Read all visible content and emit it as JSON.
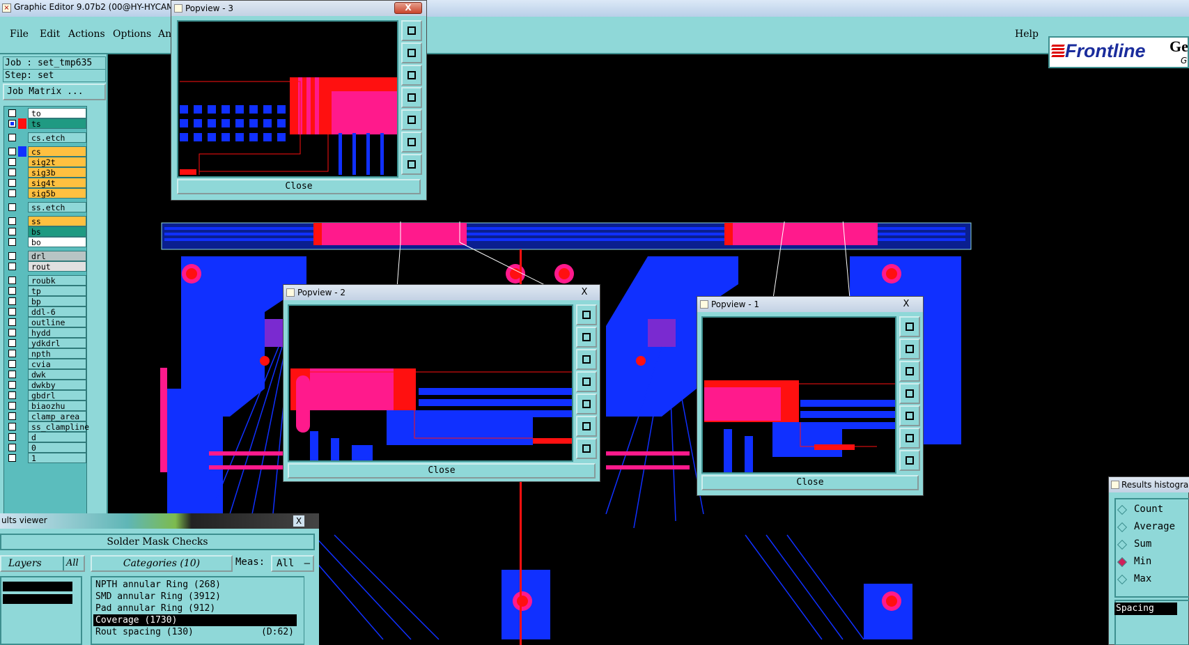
{
  "app": {
    "title": "Graphic Editor 9.07b2 (00@HY-HYCAM-PC"
  },
  "menu": {
    "file": "File",
    "edit": "Edit",
    "actions": "Actions",
    "options": "Options",
    "analysis": "Analysi",
    "help": "Help"
  },
  "logo": {
    "brand": "Frontline",
    "suffix": "Ge",
    "suffix2": "G"
  },
  "job": {
    "job_label": "Job : set_tmp635",
    "step_label": "Step: set",
    "matrix_button": "Job Matrix ..."
  },
  "layers": [
    {
      "name": "to",
      "color": "#ffffff",
      "swatch": "",
      "checked": false
    },
    {
      "name": "ts",
      "color": "#1f9a82",
      "swatch": "#ff1010",
      "checked": true
    },
    {
      "name": "cs.etch",
      "color": "#8fd8d8",
      "swatch": "",
      "checked": false
    },
    {
      "name": "cs",
      "color": "#ffc040",
      "swatch": "#1030ff",
      "checked": false
    },
    {
      "name": "sig2t",
      "color": "#ffc040",
      "swatch": "",
      "checked": false
    },
    {
      "name": "sig3b",
      "color": "#ffc040",
      "swatch": "",
      "checked": false
    },
    {
      "name": "sig4t",
      "color": "#ffc040",
      "swatch": "",
      "checked": false
    },
    {
      "name": "sig5b",
      "color": "#ffc040",
      "swatch": "",
      "checked": false
    },
    {
      "name": "ss.etch",
      "color": "#8fd8d8",
      "swatch": "",
      "checked": false
    },
    {
      "name": "ss",
      "color": "#ffc040",
      "swatch": "",
      "checked": false
    },
    {
      "name": "bs",
      "color": "#1f9a82",
      "swatch": "",
      "checked": false
    },
    {
      "name": "bo",
      "color": "#ffffff",
      "swatch": "",
      "checked": false
    },
    {
      "name": "drl",
      "color": "#b8c4c4",
      "swatch": "",
      "checked": false
    },
    {
      "name": "rout",
      "color": "#e0e0e0",
      "swatch": "",
      "checked": false
    },
    {
      "name": "roubk",
      "color": "#8fd8d8",
      "swatch": "",
      "checked": false
    },
    {
      "name": "tp",
      "color": "#8fd8d8",
      "swatch": "",
      "checked": false
    },
    {
      "name": "bp",
      "color": "#8fd8d8",
      "swatch": "",
      "checked": false
    },
    {
      "name": "ddl-6",
      "color": "#8fd8d8",
      "swatch": "",
      "checked": false
    },
    {
      "name": "outline",
      "color": "#8fd8d8",
      "swatch": "",
      "checked": false
    },
    {
      "name": "hydd",
      "color": "#8fd8d8",
      "swatch": "",
      "checked": false
    },
    {
      "name": "ydkdrl",
      "color": "#8fd8d8",
      "swatch": "",
      "checked": false
    },
    {
      "name": "npth",
      "color": "#8fd8d8",
      "swatch": "",
      "checked": false
    },
    {
      "name": "cvia",
      "color": "#8fd8d8",
      "swatch": "",
      "checked": false
    },
    {
      "name": "dwk",
      "color": "#8fd8d8",
      "swatch": "",
      "checked": false
    },
    {
      "name": "dwkby",
      "color": "#8fd8d8",
      "swatch": "",
      "checked": false
    },
    {
      "name": "gbdrl",
      "color": "#8fd8d8",
      "swatch": "",
      "checked": false
    },
    {
      "name": "biaozhu",
      "color": "#8fd8d8",
      "swatch": "",
      "checked": false
    },
    {
      "name": "clamp_area",
      "color": "#8fd8d8",
      "swatch": "",
      "checked": false
    },
    {
      "name": "ss_clampline",
      "color": "#8fd8d8",
      "swatch": "",
      "checked": false
    },
    {
      "name": "d",
      "color": "#8fd8d8",
      "swatch": "",
      "checked": false
    },
    {
      "name": "0",
      "color": "#8fd8d8",
      "swatch": "",
      "checked": false
    },
    {
      "name": "1",
      "color": "#8fd8d8",
      "swatch": "",
      "checked": false
    }
  ],
  "popups": {
    "p3": {
      "title": "Popview - 3",
      "close": "Close",
      "x": "X"
    },
    "p2": {
      "title": "Popview - 2",
      "close": "Close",
      "x": "X"
    },
    "p1": {
      "title": "Popview - 1",
      "close": "Close",
      "x": "X"
    }
  },
  "results": {
    "title": "ults viewer",
    "x": "X",
    "heading": "Solder Mask Checks",
    "layers_label": "Layers",
    "layers_all": "All",
    "categories_label": "Categories (10)",
    "meas_label": "Meas:",
    "meas_value": "All",
    "categories": [
      {
        "label": "NPTH annular Ring (268)",
        "detail": ""
      },
      {
        "label": "SMD annular Ring (3912)",
        "detail": ""
      },
      {
        "label": "Pad annular Ring (912)",
        "detail": ""
      },
      {
        "label": "Coverage (1730)",
        "detail": ""
      },
      {
        "label": "Rout spacing (130)",
        "detail": "(D:62)"
      }
    ]
  },
  "histogram": {
    "title": "Results histogra",
    "options": [
      "Count",
      "Average",
      "Sum",
      "Min",
      "Max"
    ],
    "selected": "Min",
    "spacing": "Spacing"
  },
  "colors": {
    "panel": "#8fd8d8",
    "copper": "#1030ff",
    "mask": "#ff1a8c",
    "pad": "#ff1010"
  }
}
